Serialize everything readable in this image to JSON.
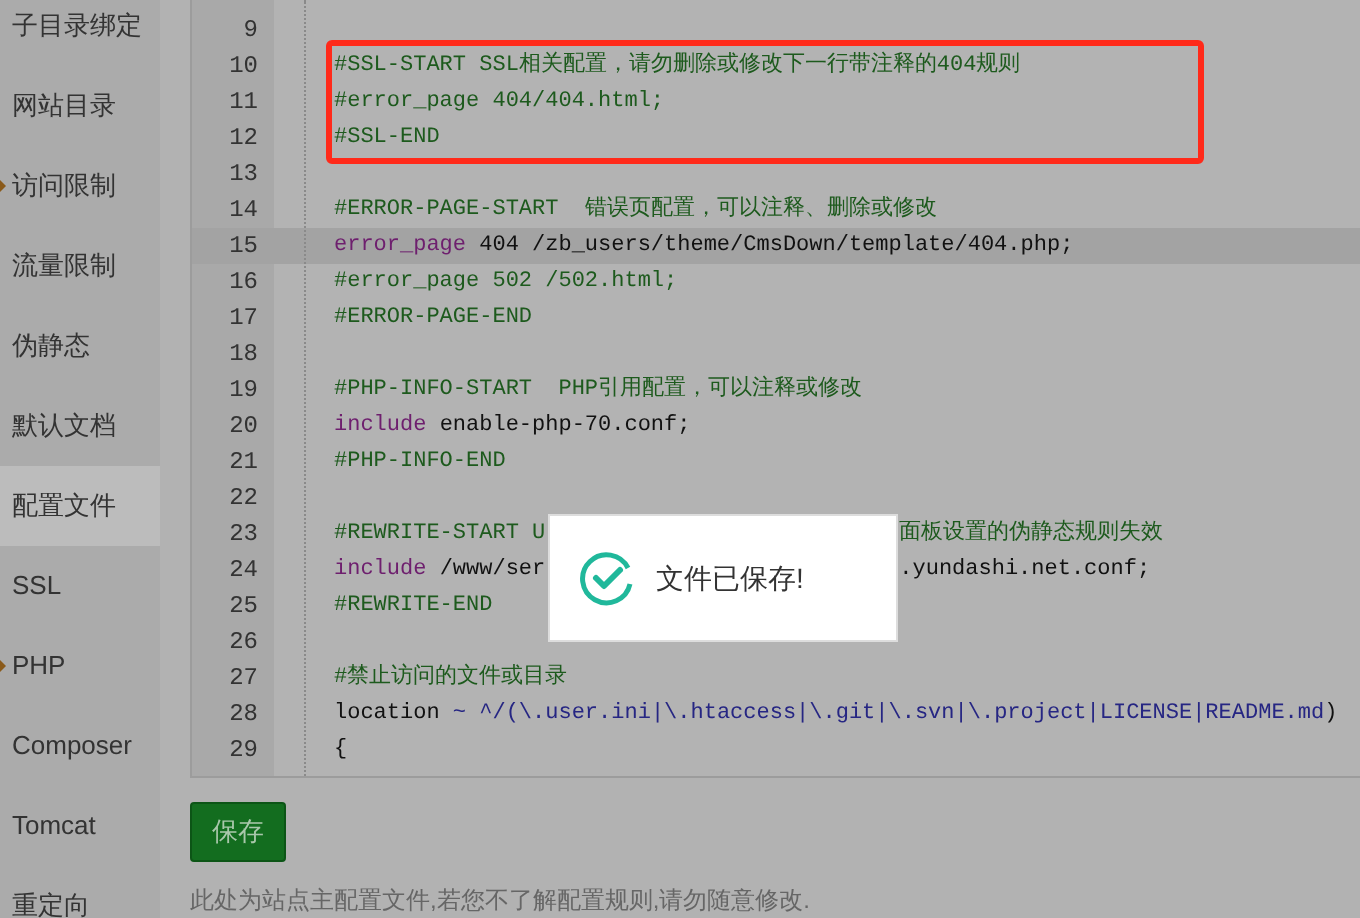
{
  "sidebar": {
    "items": [
      {
        "label": "子目录绑定",
        "selected": false,
        "flag": false
      },
      {
        "label": "网站目录",
        "selected": false,
        "flag": false
      },
      {
        "label": "访问限制",
        "selected": false,
        "flag": true
      },
      {
        "label": "流量限制",
        "selected": false,
        "flag": false
      },
      {
        "label": "伪静态",
        "selected": false,
        "flag": false
      },
      {
        "label": "默认文档",
        "selected": false,
        "flag": false
      },
      {
        "label": "配置文件",
        "selected": true,
        "flag": false
      },
      {
        "label": "SSL",
        "selected": false,
        "flag": false
      },
      {
        "label": "PHP",
        "selected": false,
        "flag": true
      },
      {
        "label": "Composer",
        "selected": false,
        "flag": false
      },
      {
        "label": "Tomcat",
        "selected": false,
        "flag": false
      },
      {
        "label": "重定向",
        "selected": false,
        "flag": false
      }
    ]
  },
  "editor": {
    "lines": [
      {
        "number": "9",
        "active": false,
        "boxed": false
      },
      {
        "number": "10",
        "active": false,
        "boxed": true,
        "segments": [
          {
            "kind": "comment",
            "text": "#SSL-START SSL相关配置，请勿删除或修改下一行带注释的404规则"
          }
        ]
      },
      {
        "number": "11",
        "active": false,
        "boxed": true,
        "segments": [
          {
            "kind": "comment",
            "text": "#error_page 404/404.html;"
          }
        ]
      },
      {
        "number": "12",
        "active": false,
        "boxed": true,
        "segments": [
          {
            "kind": "comment",
            "text": "#SSL-END"
          }
        ]
      },
      {
        "number": "13",
        "active": false,
        "boxed": false
      },
      {
        "number": "14",
        "active": false,
        "boxed": false,
        "segments": [
          {
            "kind": "comment",
            "text": "#ERROR-PAGE-START  错误页配置，可以注释、删除或修改"
          }
        ]
      },
      {
        "number": "15",
        "active": true,
        "boxed": false,
        "segments": [
          {
            "kind": "keyword",
            "text": "error_page"
          },
          {
            "kind": "plain",
            "text": " 404 /zb_users/theme/CmsDown/template/404.php;"
          }
        ]
      },
      {
        "number": "16",
        "active": false,
        "boxed": false,
        "segments": [
          {
            "kind": "comment",
            "text": "#error_page 502 /502.html;"
          }
        ]
      },
      {
        "number": "17",
        "active": false,
        "boxed": false,
        "segments": [
          {
            "kind": "comment",
            "text": "#ERROR-PAGE-END"
          }
        ]
      },
      {
        "number": "18",
        "active": false,
        "boxed": false
      },
      {
        "number": "19",
        "active": false,
        "boxed": false,
        "segments": [
          {
            "kind": "comment",
            "text": "#PHP-INFO-START  PHP引用配置，可以注释或修改"
          }
        ]
      },
      {
        "number": "20",
        "active": false,
        "boxed": false,
        "segments": [
          {
            "kind": "keyword",
            "text": "include"
          },
          {
            "kind": "plain",
            "text": " enable-php-70.conf;"
          }
        ]
      },
      {
        "number": "21",
        "active": false,
        "boxed": false,
        "segments": [
          {
            "kind": "comment",
            "text": "#PHP-INFO-END"
          }
        ]
      },
      {
        "number": "22",
        "active": false,
        "boxed": false
      },
      {
        "number": "23",
        "active": false,
        "boxed": false,
        "segments": [
          {
            "kind": "comment",
            "text": "#REWRITE-START U"
          },
          {
            "kind": "covered"
          },
          {
            "kind": "comment",
            "text": "面板设置的伪静态规则失效"
          }
        ]
      },
      {
        "number": "24",
        "active": false,
        "boxed": false,
        "segments": [
          {
            "kind": "keyword",
            "text": "include"
          },
          {
            "kind": "plain",
            "text": " /www/ser"
          },
          {
            "kind": "covered"
          },
          {
            "kind": "plain",
            "text": ".yundashi.net.conf;"
          }
        ]
      },
      {
        "number": "25",
        "active": false,
        "boxed": false,
        "segments": [
          {
            "kind": "comment",
            "text": "#REWRITE-END"
          }
        ]
      },
      {
        "number": "26",
        "active": false,
        "boxed": false
      },
      {
        "number": "27",
        "active": false,
        "boxed": false,
        "segments": [
          {
            "kind": "comment",
            "text": "#禁止访问的文件或目录"
          }
        ]
      },
      {
        "number": "28",
        "active": false,
        "boxed": false,
        "segments": [
          {
            "kind": "plain",
            "text": "location "
          },
          {
            "kind": "regex",
            "text": "~ ^/(\\.user.ini|\\.htaccess|\\.git|\\.svn|\\.project|LICENSE|README.md"
          },
          {
            "kind": "plain",
            "text": ")"
          }
        ]
      },
      {
        "number": "29",
        "active": false,
        "boxed": false,
        "segments": [
          {
            "kind": "plain",
            "text": "{"
          }
        ]
      }
    ]
  },
  "save_button": "保存",
  "note": "此处为站点主配置文件,若您不了解配置规则,请勿随意修改.",
  "toast": {
    "message": "文件已保存!"
  }
}
